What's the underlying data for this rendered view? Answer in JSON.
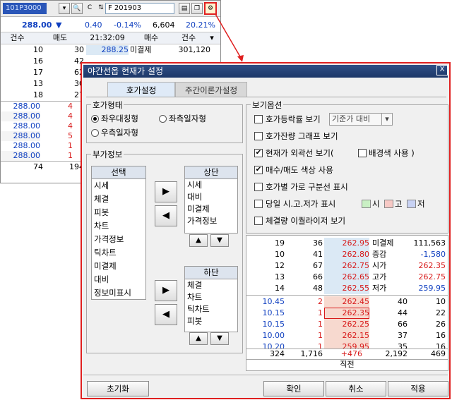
{
  "bg": {
    "symbol": "101P3000",
    "code_field": "F 201903",
    "price": "288.00",
    "arrow": "▼",
    "change": "0.40",
    "change_pct": "-0.14%",
    "volume": "6,604",
    "ratio": "20.21%",
    "headers": [
      "건수",
      "매도",
      "21:32:09",
      "매수",
      "건수"
    ],
    "ask_rows": [
      {
        "count": "10",
        "qty": "30",
        "price": "288.25",
        "label": "미결제",
        "val": "301,120"
      },
      {
        "count": "16",
        "qty": "42",
        "price": "",
        "label": "",
        "val": ""
      },
      {
        "count": "17",
        "qty": "62",
        "price": "",
        "label": "",
        "val": ""
      },
      {
        "count": "13",
        "qty": "30",
        "price": "",
        "label": "",
        "val": ""
      },
      {
        "count": "18",
        "qty": "27",
        "price": "",
        "label": "",
        "val": ""
      }
    ],
    "bid_rows": [
      {
        "price": "288.00",
        "qty": "4"
      },
      {
        "price": "288.00",
        "qty": "4"
      },
      {
        "price": "288.00",
        "qty": "4"
      },
      {
        "price": "288.00",
        "qty": "5"
      },
      {
        "price": "288.00",
        "qty": "1"
      },
      {
        "price": "288.00",
        "qty": "1"
      }
    ],
    "totals": [
      "74",
      "194"
    ]
  },
  "dialog": {
    "title": "야간선옵 현재가 설정",
    "close": "X",
    "tabs": [
      "호가설정",
      "주간이론가설정"
    ],
    "ho_group": "호가형태",
    "radio": [
      "좌우대칭형",
      "좌측일자형",
      "우측일자형"
    ],
    "extra_group": "부가정보",
    "select_header": "선택",
    "select_items": [
      "시세",
      "체결",
      "피봇",
      "차트",
      "가격정보",
      "틱차트",
      "미결제",
      "대비",
      "정보미표시"
    ],
    "top_header": "상단",
    "top_items": [
      "시세",
      "대비",
      "미결제",
      "가격정보"
    ],
    "bottom_header": "하단",
    "bottom_items": [
      "체결",
      "차트",
      "틱차트",
      "피봇"
    ],
    "arrow_right": "▶",
    "arrow_left": "◀",
    "arrow_up": "▲",
    "arrow_down": "▼",
    "view_group": "보기옵션",
    "options": {
      "o1": "호가등락률 보기",
      "o1_select": "기준가 대비",
      "o2": "호가잔량 그래프 보기",
      "o3": "현재가 외곽선 보기(",
      "o3b": "배경색 사용 )",
      "o4": "매수/매도 색상 사용",
      "o5": "호가별 가로 구분선 표시",
      "o6": "당일 시.고.저가 표시",
      "sw_open": "시",
      "sw_high": "고",
      "sw_low": "저",
      "o7": "체결량 이퀄라이저 보기"
    },
    "preview": {
      "ask": [
        {
          "c": "19",
          "q": "36",
          "p": "262.95",
          "l": "미결제",
          "v": "111,563",
          "vc": "k"
        },
        {
          "c": "10",
          "q": "41",
          "p": "262.80",
          "l": "증감",
          "v": "-1,580",
          "vc": "b"
        },
        {
          "c": "12",
          "q": "67",
          "p": "262.75",
          "l": "시가",
          "v": "262.35",
          "vc": "r"
        },
        {
          "c": "13",
          "q": "66",
          "p": "262.65",
          "l": "고가",
          "v": "262.75",
          "vc": "r"
        },
        {
          "c": "14",
          "q": "48",
          "p": "262.55",
          "l": "저가",
          "v": "259.95",
          "vc": "b"
        }
      ],
      "bid": [
        {
          "a": "10.45",
          "q": "2",
          "p": "262.45",
          "bq": "40",
          "bc": "10"
        },
        {
          "a": "10.15",
          "q": "1",
          "p": "262.35",
          "bq": "44",
          "bc": "22"
        },
        {
          "a": "10.15",
          "q": "1",
          "p": "262.25",
          "bq": "66",
          "bc": "26"
        },
        {
          "a": "10.00",
          "q": "1",
          "p": "262.15",
          "bq": "37",
          "bc": "16"
        },
        {
          "a": "10.20",
          "q": "1",
          "p": "259.95",
          "bq": "35",
          "bc": "16"
        }
      ],
      "totals": [
        "324",
        "1,716",
        "+476",
        "2,192",
        "469"
      ],
      "footer": "직전"
    },
    "buttons": {
      "reset": "초기화",
      "ok": "확인",
      "cancel": "취소",
      "apply": "적용"
    }
  },
  "colors": {
    "accent_red": "#e02020",
    "title_bar": "#1c3768",
    "ask_price_bg": "#dbe9f5",
    "bid_price_bg": "#f7d9cf"
  }
}
